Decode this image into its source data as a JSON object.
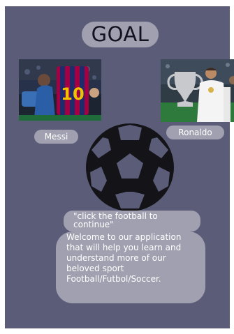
{
  "app": {
    "title": "GOAL"
  },
  "players": {
    "left": {
      "name": "Messi",
      "photo_icon": "messi-photo-icon"
    },
    "right": {
      "name": "Ronaldo",
      "photo_icon": "ronaldo-photo-icon"
    }
  },
  "football": {
    "icon": "football-icon"
  },
  "hint": {
    "text": "\"click the football to continue\""
  },
  "welcome": {
    "text": "Welcome to our application that will help you learn and understand more of our beloved sport Football/Futbol/Soccer."
  },
  "colors": {
    "background": "#5b5d78",
    "pill": "#a0a0b0",
    "title_text": "#11131f",
    "text": "#ffffff",
    "ball": "#141418"
  }
}
